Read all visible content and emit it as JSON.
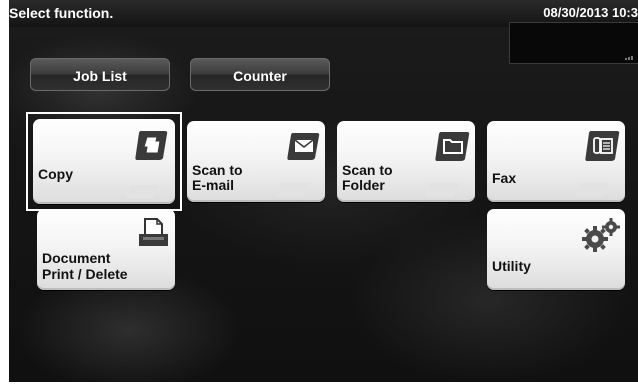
{
  "header": {
    "prompt": "Select function.",
    "datetime": "08/30/2013 10:3"
  },
  "tabs": {
    "job_list": "Job List",
    "counter": "Counter"
  },
  "functions": {
    "copy": {
      "line1": "Copy",
      "line2": "",
      "selected": true,
      "icon": "copy-icon"
    },
    "scan_email": {
      "line1": "Scan to",
      "line2": "E-mail",
      "icon": "envelope-icon"
    },
    "scan_folder": {
      "line1": "Scan to",
      "line2": "Folder",
      "icon": "folder-icon"
    },
    "fax": {
      "line1": "Fax",
      "line2": "",
      "icon": "fax-icon"
    },
    "document": {
      "line1": "Document",
      "line2": "Print / Delete",
      "icon": "printer-icon"
    },
    "utility": {
      "line1": "Utility",
      "line2": "",
      "icon": "gear-icon"
    }
  },
  "colors": {
    "background": "#151515",
    "tile": "#f4f4f4",
    "icon_dark": "#3a3a3a",
    "text_light": "#ffffff",
    "text_dark": "#111111"
  }
}
